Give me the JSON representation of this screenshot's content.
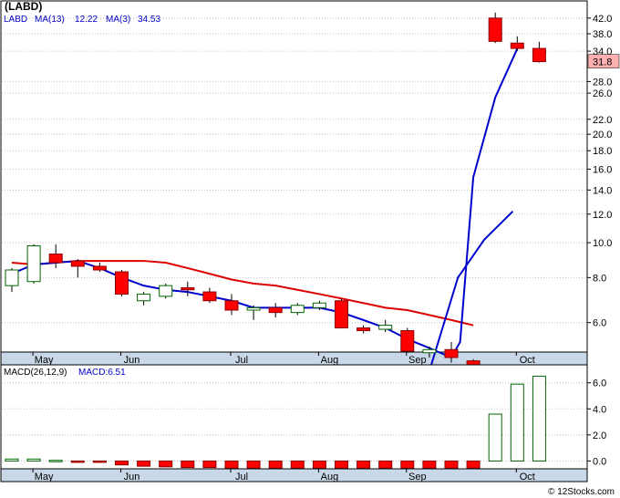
{
  "colors": {
    "background": "#ffffff",
    "panel_border": "#000000",
    "grid": "#c0c0c0",
    "up_candle_fill": "#ffffff",
    "up_candle_stroke": "#006400",
    "down_candle": "#ff0000",
    "down_candle_stroke": "#8b0000",
    "ma13": "#0000cc",
    "ma3": "#0000cc",
    "ma_slow": "#dd0000",
    "macd_legend": "#0000cc",
    "last_price_box": "#ffb0b0",
    "axis_band": "#c8d8e8"
  },
  "chart_data": [
    {
      "type": "candlestick",
      "title": "(LABD)",
      "scale": "log",
      "ylim": [
        5.0,
        45.0
      ],
      "y_ticks": [
        "42.0",
        "38.0",
        "34.0",
        "31.8",
        "28.0",
        "26.0",
        "22.0",
        "20.0",
        "18.0",
        "16.0",
        "14.0",
        "12.0",
        "10.0",
        "8.0",
        "6.0"
      ],
      "y_tick_values": [
        42,
        38,
        34,
        28,
        26,
        22,
        20,
        18,
        16,
        14,
        12,
        10,
        8,
        6
      ],
      "last_price": {
        "label": "31.8",
        "value": 31.8
      },
      "x_ticks": [
        {
          "label": "May",
          "index": 1
        },
        {
          "label": "Jun",
          "index": 5
        },
        {
          "label": "Jul",
          "index": 10
        },
        {
          "label": "Aug",
          "index": 14
        },
        {
          "label": "Sep",
          "index": 18
        },
        {
          "label": "Oct",
          "index": 23
        }
      ],
      "legend": [
        {
          "label": "LABD",
          "color": "#0000cc"
        },
        {
          "label": "MA(13)",
          "value": "12.22",
          "color": "#0000cc"
        },
        {
          "label": "MA(3)",
          "value": "34.53",
          "color": "#0000cc"
        }
      ],
      "candles": [
        {
          "o": 7.6,
          "h": 8.5,
          "l": 7.3,
          "c": 8.4
        },
        {
          "o": 7.8,
          "h": 9.9,
          "l": 7.7,
          "c": 9.8
        },
        {
          "o": 9.3,
          "h": 9.9,
          "l": 8.5,
          "c": 8.8
        },
        {
          "o": 8.9,
          "h": 9.0,
          "l": 8.0,
          "c": 8.6
        },
        {
          "o": 8.6,
          "h": 8.8,
          "l": 8.3,
          "c": 8.4
        },
        {
          "o": 8.3,
          "h": 8.4,
          "l": 7.1,
          "c": 7.2
        },
        {
          "o": 6.9,
          "h": 7.3,
          "l": 6.7,
          "c": 7.2
        },
        {
          "o": 7.1,
          "h": 7.7,
          "l": 7.0,
          "c": 7.6
        },
        {
          "o": 7.5,
          "h": 7.8,
          "l": 7.1,
          "c": 7.4
        },
        {
          "o": 7.3,
          "h": 7.5,
          "l": 6.8,
          "c": 6.9
        },
        {
          "o": 6.9,
          "h": 7.2,
          "l": 6.3,
          "c": 6.5
        },
        {
          "o": 6.5,
          "h": 6.7,
          "l": 6.1,
          "c": 6.6
        },
        {
          "o": 6.6,
          "h": 6.8,
          "l": 6.2,
          "c": 6.4
        },
        {
          "o": 6.4,
          "h": 6.8,
          "l": 6.3,
          "c": 6.7
        },
        {
          "o": 6.6,
          "h": 6.9,
          "l": 6.5,
          "c": 6.8
        },
        {
          "o": 6.9,
          "h": 7.0,
          "l": 5.8,
          "c": 5.8
        },
        {
          "o": 5.8,
          "h": 5.9,
          "l": 5.6,
          "c": 5.7
        },
        {
          "o": 5.75,
          "h": 6.1,
          "l": 5.65,
          "c": 5.9
        },
        {
          "o": 5.7,
          "h": 5.8,
          "l": 4.95,
          "c": 5.0
        },
        {
          "o": 4.95,
          "h": 5.15,
          "l": 4.8,
          "c": 5.05
        },
        {
          "o": 5.05,
          "h": 5.3,
          "l": 4.65,
          "c": 4.8
        },
        {
          "o": 4.7,
          "h": 4.75,
          "l": 4.4,
          "c": 4.4
        },
        {
          "o": 42.0,
          "h": 43.5,
          "l": 35.8,
          "c": 36.2
        },
        {
          "o": 35.8,
          "h": 37.4,
          "l": 34.0,
          "c": 34.6
        },
        {
          "o": 34.6,
          "h": 36.1,
          "l": 31.6,
          "c": 31.8
        }
      ],
      "series": [
        {
          "name": "MA(13)",
          "color": "#0000cc",
          "points": [
            [
              19,
              4.4
            ],
            [
              20.3,
              8.0
            ],
            [
              21.5,
              10.2
            ],
            [
              22.8,
              12.22
            ]
          ]
        },
        {
          "name": "MA(3)",
          "color": "#0000cc",
          "points": [
            [
              0,
              8.2
            ],
            [
              1,
              8.7
            ],
            [
              2,
              8.8
            ],
            [
              3,
              8.9
            ],
            [
              4,
              8.5
            ],
            [
              5,
              8.0
            ],
            [
              6,
              7.6
            ],
            [
              7,
              7.4
            ],
            [
              8,
              7.3
            ],
            [
              9,
              7.1
            ],
            [
              10,
              6.9
            ],
            [
              11,
              6.6
            ],
            [
              12,
              6.6
            ],
            [
              13,
              6.6
            ],
            [
              14,
              6.6
            ],
            [
              15,
              6.4
            ],
            [
              16,
              6.1
            ],
            [
              17,
              5.8
            ],
            [
              18,
              5.4
            ],
            [
              19,
              5.1
            ],
            [
              20,
              4.8
            ],
            [
              20.4,
              5.3
            ],
            [
              21.0,
              15.2
            ],
            [
              22.0,
              25.3
            ],
            [
              23.0,
              34.53
            ]
          ]
        },
        {
          "color": "#dd0000",
          "points": [
            [
              0,
              8.8
            ],
            [
              1,
              8.7
            ],
            [
              2,
              8.8
            ],
            [
              3,
              8.9
            ],
            [
              4,
              8.9
            ],
            [
              5,
              8.9
            ],
            [
              6,
              8.9
            ],
            [
              7,
              8.8
            ],
            [
              8,
              8.5
            ],
            [
              9,
              8.2
            ],
            [
              10,
              7.9
            ],
            [
              11,
              7.7
            ],
            [
              12,
              7.6
            ],
            [
              13,
              7.4
            ],
            [
              14,
              7.2
            ],
            [
              15,
              7.0
            ],
            [
              16,
              6.8
            ],
            [
              17,
              6.6
            ],
            [
              18,
              6.5
            ],
            [
              19,
              6.3
            ],
            [
              20,
              6.1
            ],
            [
              21,
              5.9
            ]
          ]
        }
      ]
    },
    {
      "type": "bar",
      "title": "MACD",
      "legend": [
        {
          "label": "MACD(26,12,9)",
          "color": "#000000"
        },
        {
          "label": "MACD:6.51",
          "color": "#0000cc"
        }
      ],
      "ylim": [
        -0.6,
        7.1
      ],
      "y_ticks": [
        "6.0",
        "4.0",
        "2.0",
        "0.0"
      ],
      "y_tick_values": [
        6,
        4,
        2,
        0
      ],
      "values": [
        0.15,
        0.15,
        0.05,
        -0.04,
        -0.1,
        -0.3,
        -0.4,
        -0.45,
        -0.5,
        -0.5,
        -0.55,
        -0.55,
        -0.55,
        -0.55,
        -0.55,
        -0.55,
        -0.55,
        -0.55,
        -0.55,
        -0.55,
        -0.55,
        -0.55,
        3.6,
        5.9,
        6.51
      ],
      "x_ticks": [
        {
          "label": "May",
          "index": 1
        },
        {
          "label": "Jun",
          "index": 5
        },
        {
          "label": "Jul",
          "index": 10
        },
        {
          "label": "Aug",
          "index": 14
        },
        {
          "label": "Sep",
          "index": 18
        },
        {
          "label": "Oct",
          "index": 23
        }
      ]
    }
  ],
  "footer": {
    "watermark": "© 12Stocks.com"
  }
}
